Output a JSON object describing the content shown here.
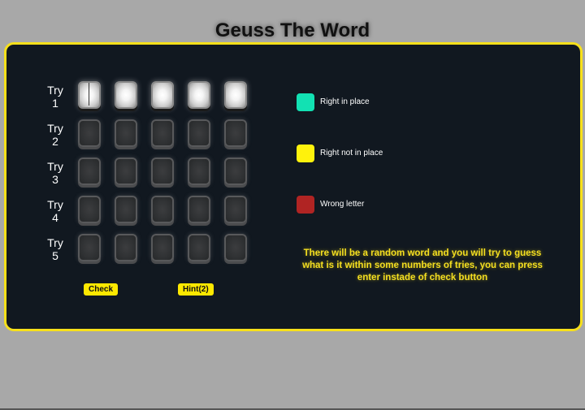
{
  "header": {
    "title": "Geuss The Word"
  },
  "game": {
    "word_length": 5,
    "active_try": 1,
    "tries": [
      {
        "label": "Try",
        "number": "1",
        "letters": [
          "",
          "",
          "",
          "",
          ""
        ],
        "state": "active"
      },
      {
        "label": "Try",
        "number": "2",
        "letters": [
          "",
          "",
          "",
          "",
          ""
        ],
        "state": "disabled"
      },
      {
        "label": "Try",
        "number": "3",
        "letters": [
          "",
          "",
          "",
          "",
          ""
        ],
        "state": "disabled"
      },
      {
        "label": "Try",
        "number": "4",
        "letters": [
          "",
          "",
          "",
          "",
          ""
        ],
        "state": "disabled"
      },
      {
        "label": "Try",
        "number": "5",
        "letters": [
          "",
          "",
          "",
          "",
          ""
        ],
        "state": "disabled"
      }
    ],
    "buttons": {
      "check_label": "Check",
      "hint_label": "Hint(2)"
    }
  },
  "legend": {
    "items": [
      {
        "label": "Right in place",
        "color": "#12e1b3"
      },
      {
        "label": "Right not in place",
        "color": "#fff20c"
      },
      {
        "label": "Wrong letter",
        "color": "#b02423"
      }
    ]
  },
  "instructions": {
    "text": "There will be a random word and you will try to guess what is it within some numbers of tries, you can press enter instade of check button"
  },
  "theme": {
    "accent": "#f7e01a",
    "panel_bg": "#111820",
    "page_bg": "#a8a8a8"
  }
}
